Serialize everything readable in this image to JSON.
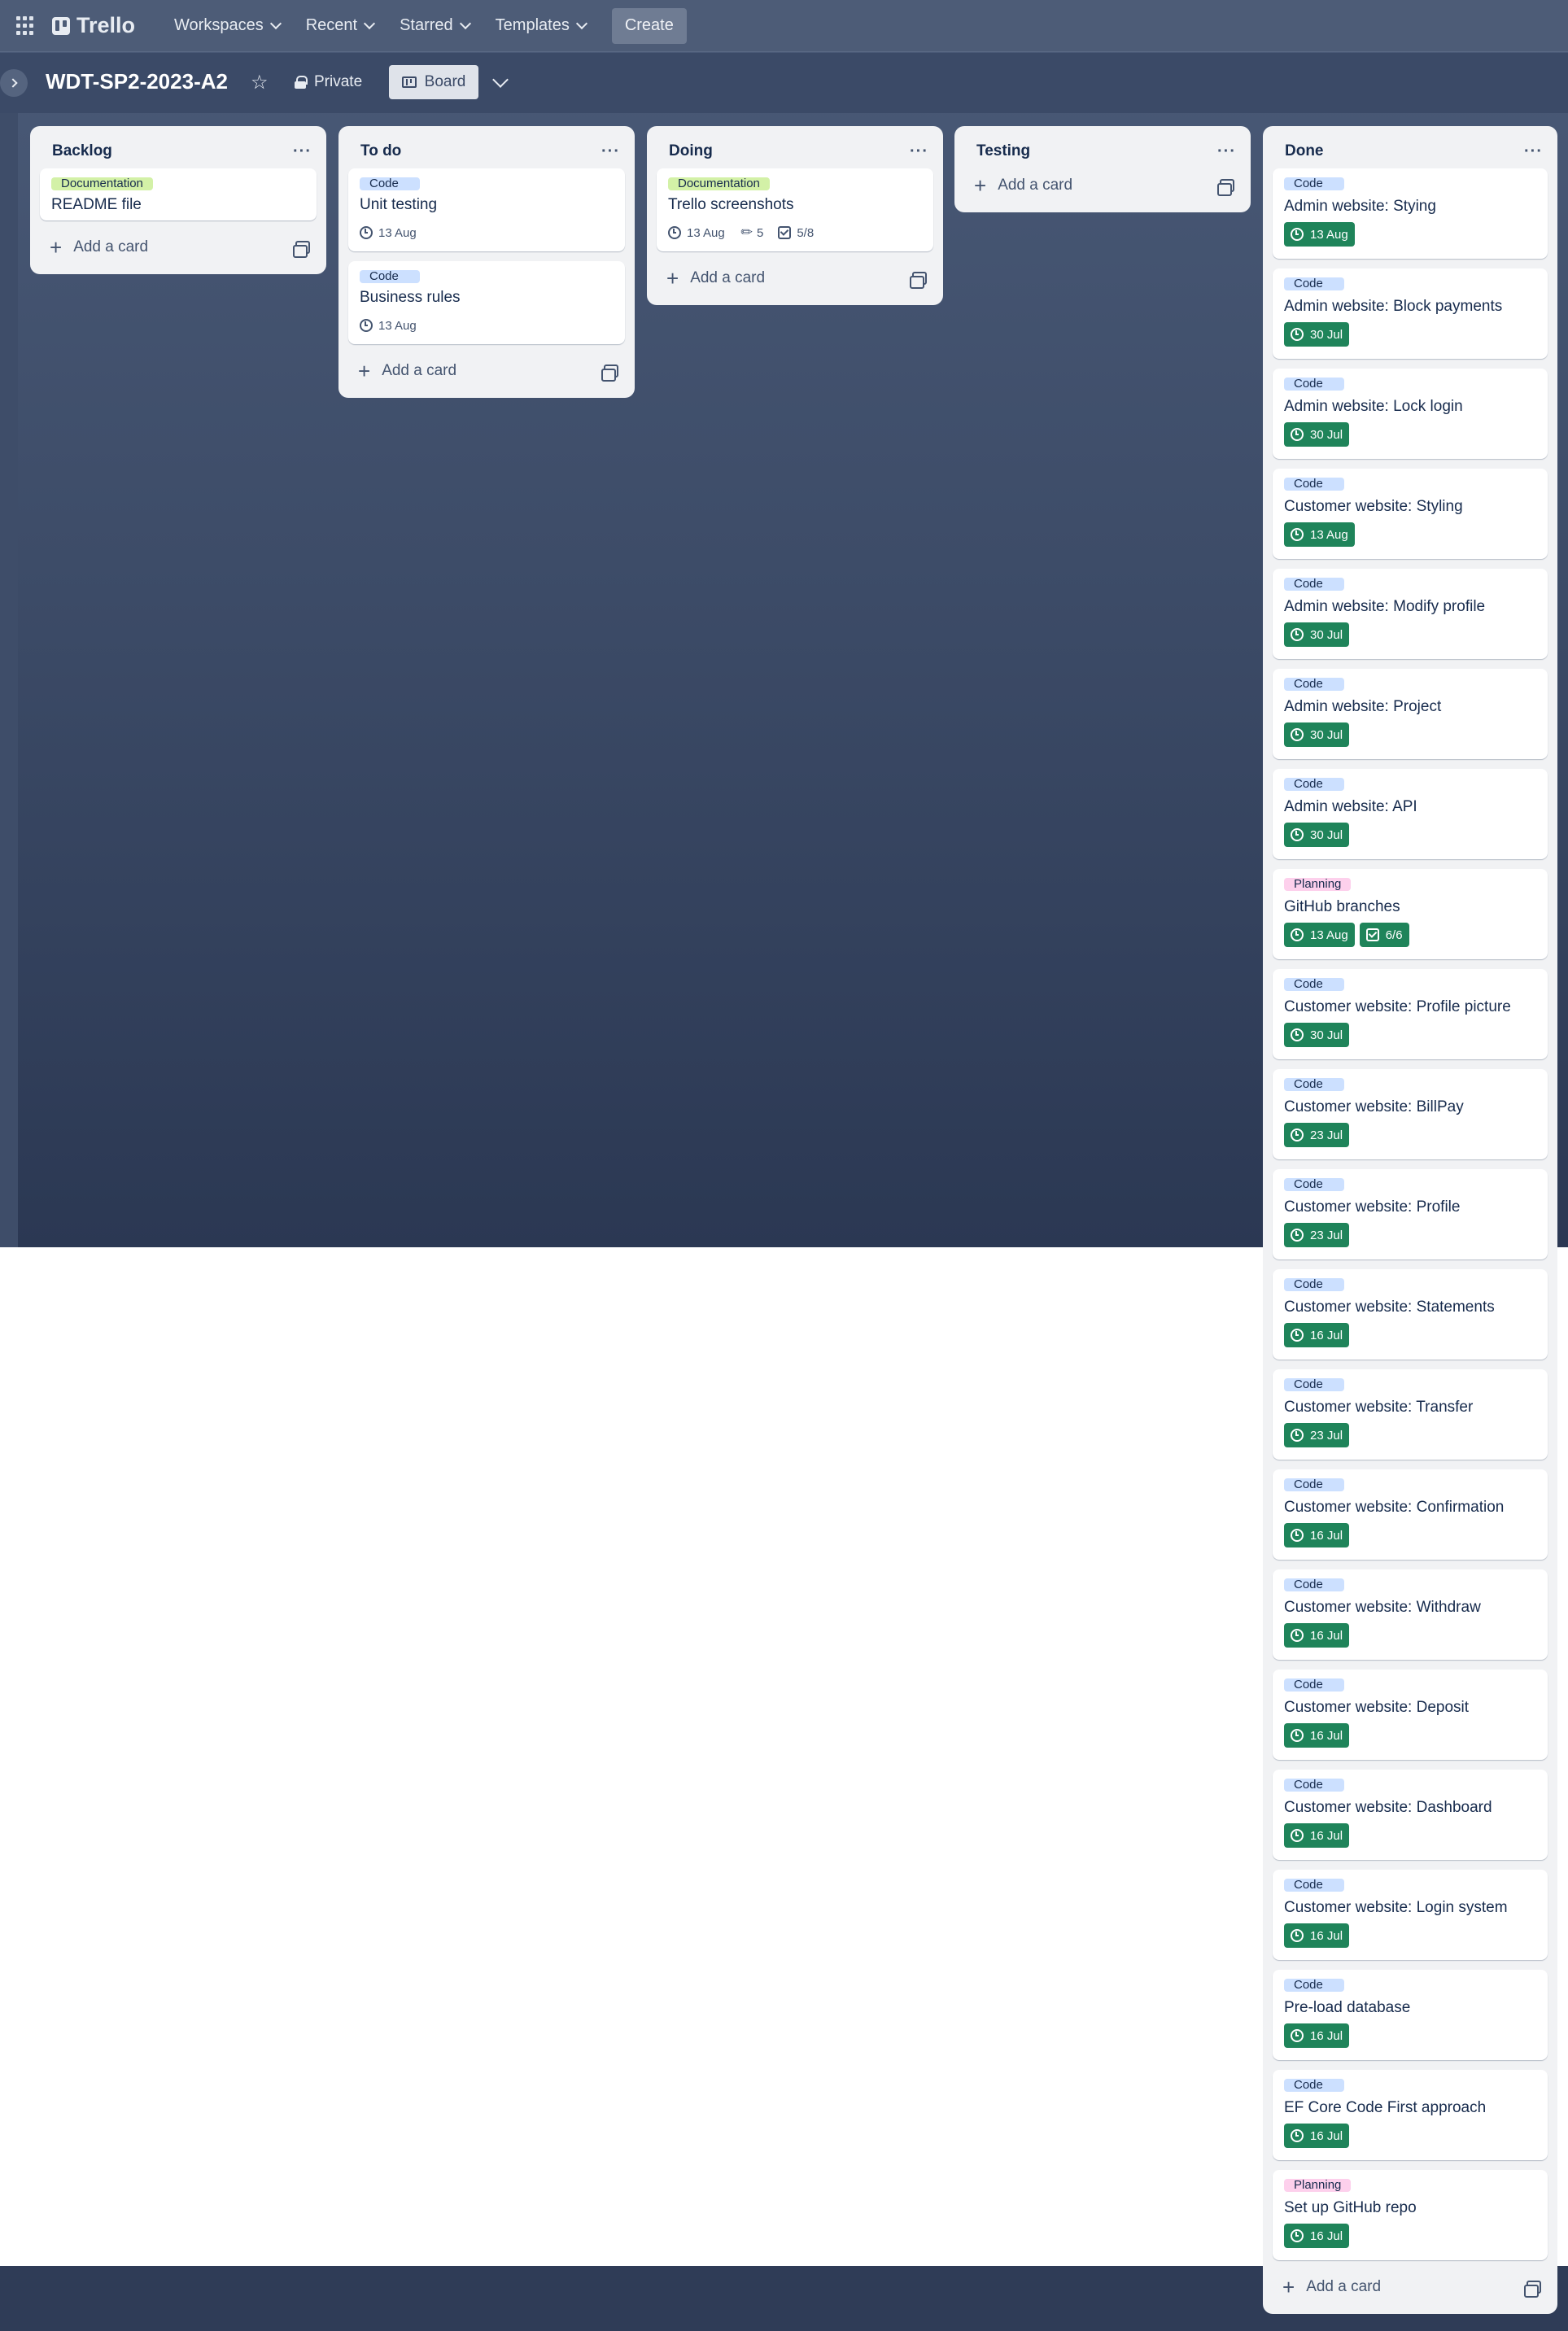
{
  "nav": {
    "logo": "Trello",
    "items": [
      "Workspaces",
      "Recent",
      "Starred",
      "Templates"
    ],
    "create": "Create"
  },
  "board": {
    "title": "WDT-SP2-2023-A2",
    "visibility": "Private",
    "view": "Board"
  },
  "add_card_label": "Add a card",
  "lists": [
    {
      "title": "Backlog",
      "cards": [
        {
          "label": "Documentation",
          "label_type": "doc",
          "title": "README file"
        }
      ]
    },
    {
      "title": "To do",
      "cards": [
        {
          "label": "Code",
          "label_type": "code",
          "title": "Unit testing",
          "due": "13 Aug"
        },
        {
          "label": "Code",
          "label_type": "code",
          "title": "Business rules",
          "due": "13 Aug"
        }
      ]
    },
    {
      "title": "Doing",
      "cards": [
        {
          "label": "Documentation",
          "label_type": "doc",
          "title": "Trello screenshots",
          "due": "13 Aug",
          "attachments": "5",
          "checklist": "5/8"
        }
      ]
    },
    {
      "title": "Testing",
      "cards": []
    },
    {
      "title": "Done",
      "cards": [
        {
          "label": "Code",
          "title": "Admin website: Stying",
          "due": "13 Aug"
        },
        {
          "label": "Code",
          "title": "Admin website: Block payments",
          "due": "30 Jul"
        },
        {
          "label": "Code",
          "title": "Admin website: Lock login",
          "due": "30 Jul"
        },
        {
          "label": "Code",
          "title": "Customer website: Styling",
          "due": "13 Aug"
        },
        {
          "label": "Code",
          "title": "Admin website: Modify profile",
          "due": "30 Jul"
        },
        {
          "label": "Code",
          "title": "Admin website: Project",
          "due": "30 Jul"
        },
        {
          "label": "Code",
          "title": "Admin website: API",
          "due": "30 Jul"
        },
        {
          "label": "Planning",
          "title": "GitHub branches",
          "due": "13 Aug",
          "checklist": "6/6"
        },
        {
          "label": "Code",
          "title": "Customer website: Profile picture",
          "due": "30 Jul"
        },
        {
          "label": "Code",
          "title": "Customer website: BillPay",
          "due": "23 Jul"
        },
        {
          "label": "Code",
          "title": "Customer website: Profile",
          "due": "23 Jul"
        },
        {
          "label": "Code",
          "title": "Customer website: Statements",
          "due": "16 Jul"
        },
        {
          "label": "Code",
          "title": "Customer website: Transfer",
          "due": "23 Jul"
        },
        {
          "label": "Code",
          "title": "Customer website: Confirmation",
          "due": "16 Jul"
        },
        {
          "label": "Code",
          "title": "Customer website: Withdraw",
          "due": "16 Jul"
        },
        {
          "label": "Code",
          "title": "Customer website: Deposit",
          "due": "16 Jul"
        },
        {
          "label": "Code",
          "title": "Customer website: Dashboard",
          "due": "16 Jul"
        },
        {
          "label": "Code",
          "title": "Customer website: Login system",
          "due": "16 Jul"
        },
        {
          "label": "Code",
          "title": "Pre-load database",
          "due": "16 Jul"
        },
        {
          "label": "Code",
          "title": "EF Core Code First approach",
          "due": "16 Jul"
        },
        {
          "label": "Planning",
          "title": "Set up GitHub repo",
          "due": "16 Jul"
        }
      ]
    }
  ],
  "colors": {
    "label_code": "#cce0ff",
    "label_documentation": "#d3f1a7",
    "label_planning": "#fdd0ec",
    "due_complete": "#1f845a",
    "list_bg": "#f1f2f4"
  }
}
